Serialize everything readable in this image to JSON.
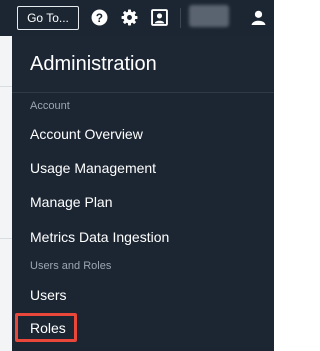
{
  "topbar": {
    "goto_label": "Go To...",
    "icons": [
      "help-icon",
      "settings-gear-icon",
      "contact-card-icon",
      "user-avatar-icon"
    ],
    "accent": "#1c2633"
  },
  "menu": {
    "title": "Administration",
    "sections": [
      {
        "label": "Account",
        "items": [
          "Account Overview",
          "Usage Management",
          "Manage Plan",
          "Metrics Data Ingestion"
        ]
      },
      {
        "label": "Users and Roles",
        "items": [
          "Users",
          "Roles"
        ]
      }
    ],
    "highlight_color": "#e8473a"
  }
}
